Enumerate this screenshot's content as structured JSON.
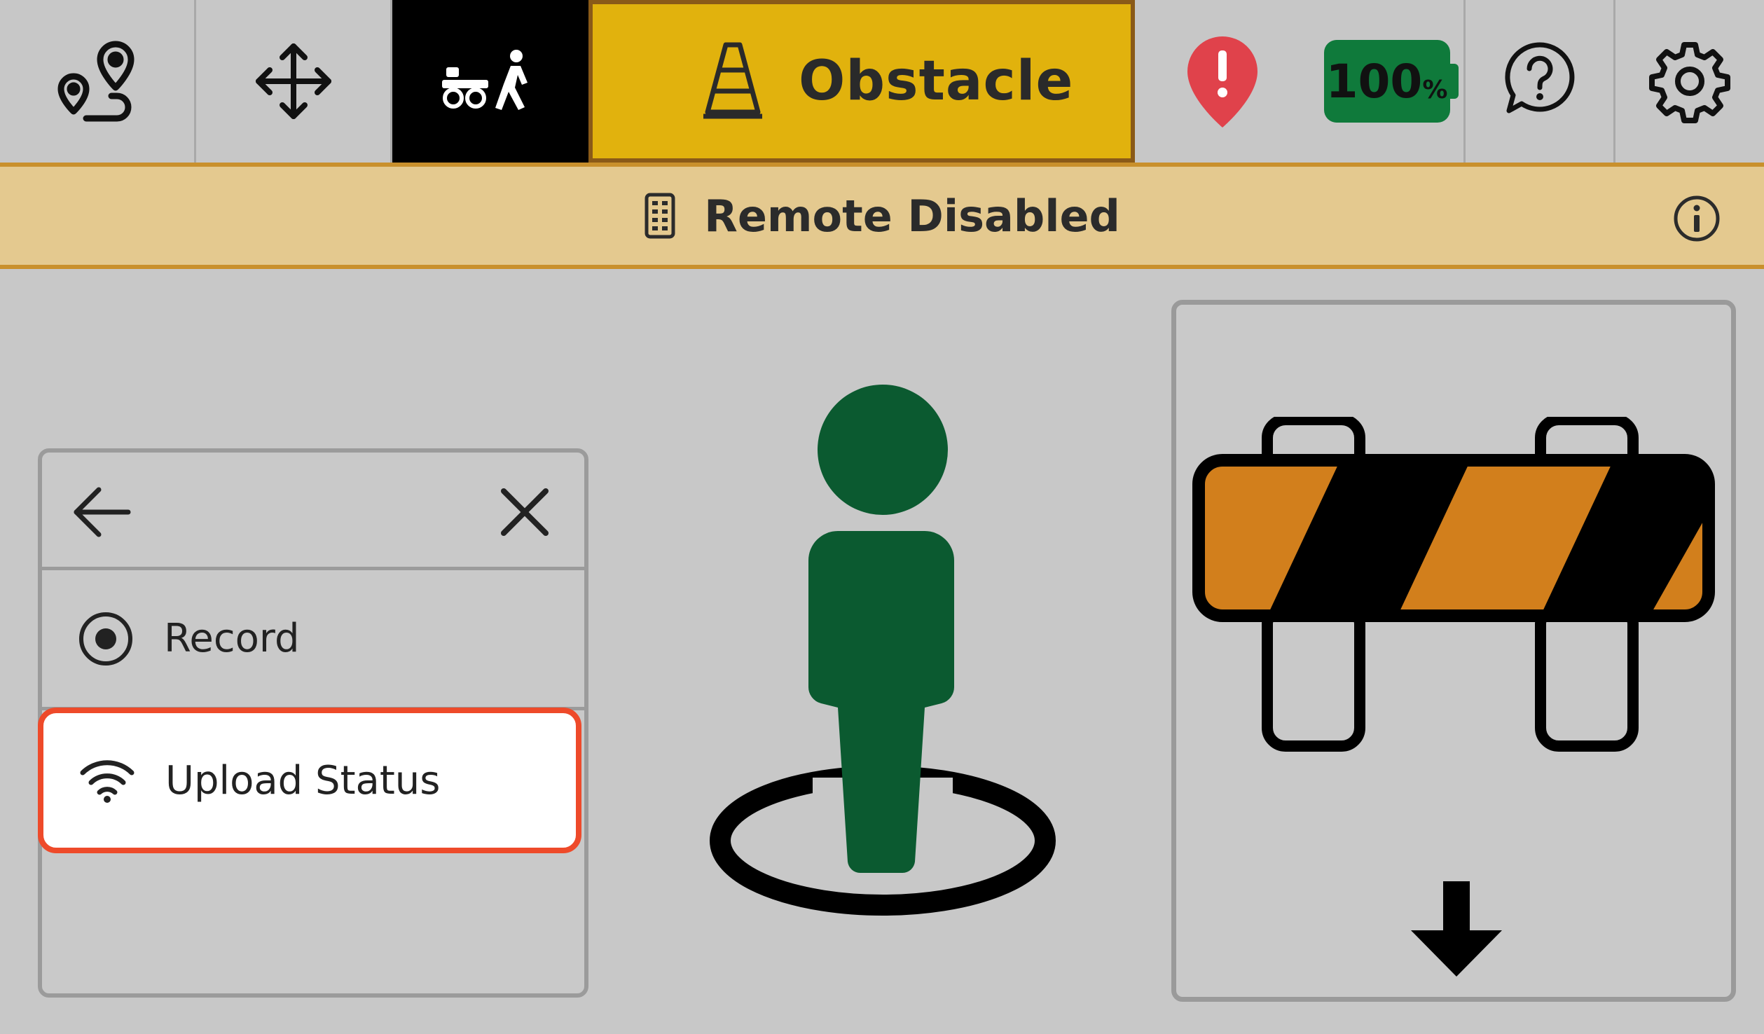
{
  "topbar": {
    "items": [
      {
        "icon": "route-icon"
      },
      {
        "icon": "move-arrows-icon"
      },
      {
        "icon": "robot-follow-person-icon",
        "active_bg": "#000000"
      },
      {
        "icon": "traffic-cone-icon",
        "label": "Obstacle",
        "bg": "#e1b20d"
      },
      {
        "icon": "alert-pin-icon",
        "color": "#e0424b"
      },
      {
        "icon": "battery-icon",
        "value": "100",
        "unit": "%",
        "color": "#0f7a3b"
      },
      {
        "icon": "help-bubble-icon"
      },
      {
        "icon": "gear-icon"
      }
    ]
  },
  "status": {
    "icon": "remote-icon",
    "text": "Remote Disabled",
    "info_icon": "info-icon",
    "bg": "#e4c98f",
    "border": "#c9902c"
  },
  "menu": {
    "back_icon": "arrow-left-icon",
    "close_icon": "close-icon",
    "items": [
      {
        "icon": "record-icon",
        "label": "Record"
      },
      {
        "icon": "wifi-icon",
        "label": "Upload Status",
        "highlighted": true
      }
    ],
    "highlight_color": "#ee4a2a"
  },
  "figure": {
    "icon": "person-location-icon",
    "color": "#0b5a30"
  },
  "barricade": {
    "icon": "barricade-icon",
    "stripe_color": "#d27f1c",
    "button_icon": "arrow-down-icon"
  }
}
